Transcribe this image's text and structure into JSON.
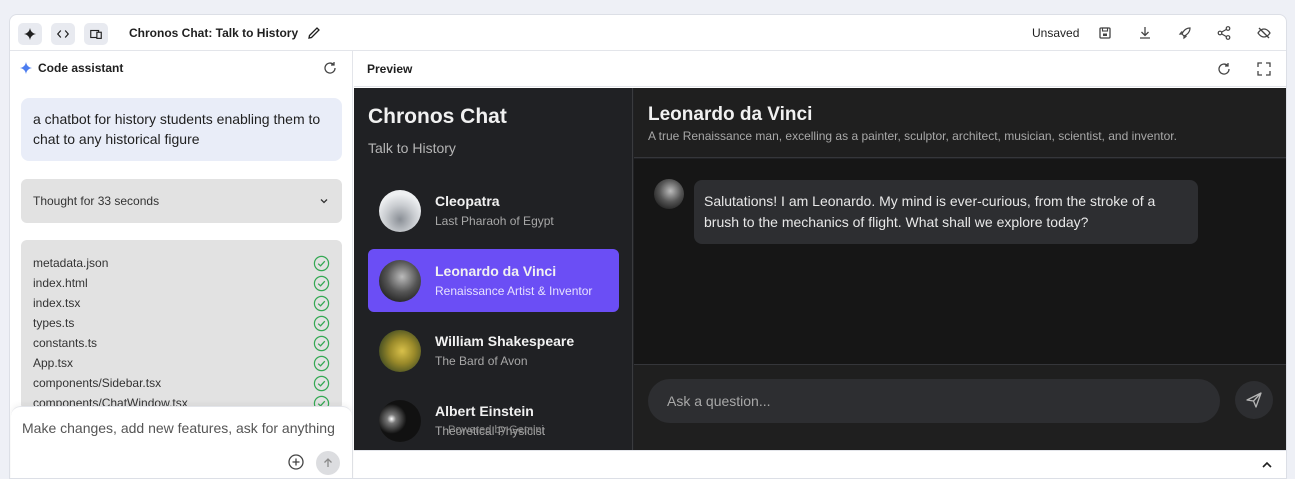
{
  "topbar": {
    "title": "Chronos Chat: Talk to History",
    "status": "Unsaved",
    "icons": [
      "sparkle-icon",
      "code-icon",
      "device-icon",
      "edit-icon",
      "save-icon",
      "download-icon",
      "deploy-icon",
      "share-icon",
      "hide-icon"
    ]
  },
  "assistant": {
    "header": "Code assistant",
    "prompt": "a chatbot for history students enabling them to chat to any historical figure",
    "thought": "Thought for 33 seconds",
    "files": [
      "metadata.json",
      "index.html",
      "index.tsx",
      "types.ts",
      "constants.ts",
      "App.tsx",
      "components/Sidebar.tsx",
      "components/ChatWindow.tsx"
    ],
    "composer_placeholder": "Make changes, add new features, ask for anything"
  },
  "preview": {
    "header": "Preview"
  },
  "chronos": {
    "title": "Chronos Chat",
    "subtitle": "Talk to History",
    "figures": [
      {
        "name": "Cleopatra",
        "role": "Last Pharaoh of Egypt"
      },
      {
        "name": "Leonardo da Vinci",
        "role": "Renaissance Artist & Inventor"
      },
      {
        "name": "William Shakespeare",
        "role": "The Bard of Avon"
      },
      {
        "name": "Albert Einstein",
        "role": "Theoretical Physicist"
      }
    ],
    "active_index": 1,
    "powered": "Powered by Gemini",
    "chat": {
      "name": "Leonardo da Vinci",
      "description": "A true Renaissance man, excelling as a painter, sculptor, architect, musician, scientist, and inventor.",
      "message": "Salutations! I am Leonardo. My mind is ever-curious, from the stroke of a brush to the mechanics of flight. What shall we explore today?",
      "input_placeholder": "Ask a question..."
    },
    "accent": "#6b4ef5"
  }
}
